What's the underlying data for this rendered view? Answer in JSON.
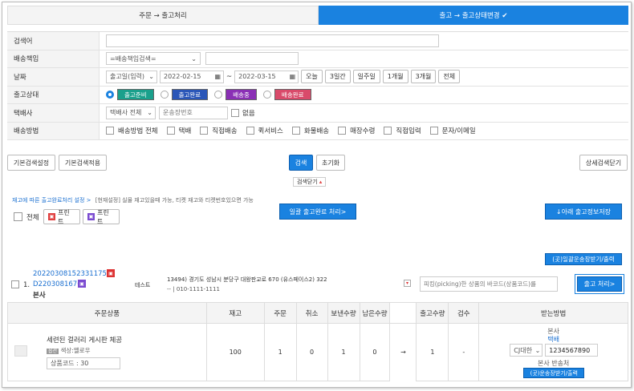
{
  "tabs": [
    {
      "label": "주문 → 출고처리"
    },
    {
      "label": "출고 → 출고상태변경 ✔"
    }
  ],
  "form": {
    "search_label": "검색어",
    "shipping_label": "배송책임",
    "shipping_select": "=배송책임검색=",
    "date_label": "날짜",
    "date_type": "출고일(입력)",
    "date_from": "2022-02-15",
    "date_sep": "~",
    "date_to": "2022-03-15",
    "date_buttons": [
      "오늘",
      "3일간",
      "일주일",
      "1개월",
      "3개월",
      "전체"
    ],
    "status_label": "출고상태",
    "statuses": [
      "출고준비",
      "출고완료",
      "배송중",
      "배송완료"
    ],
    "carrier_label": "택배사",
    "carrier_select": "택배사 전체",
    "tracking_placeholder": "운송장번호",
    "none_label": "없음",
    "method_label": "배송방법",
    "methods": [
      "배송방법 전체",
      "택배",
      "직접배송",
      "퀵서비스",
      "화물배송",
      "매장수령",
      "직접입력",
      "문자/이메일"
    ]
  },
  "actions": {
    "basic_save": "기본검색설정",
    "basic_apply": "기본검색적용",
    "search": "검색",
    "reset": "초기화",
    "detail_close": "상세검색닫기",
    "search_close": "검색닫기"
  },
  "notice": {
    "link": "재고에 따른 출고완료처리 설정 >",
    "text": "[현재설정] 실물 재고있을때 가능,  티켓 재고와 티켓번호있으면 가능"
  },
  "list_toolbar": {
    "all_label": "전체",
    "print1": "프린트",
    "print2": "프린트",
    "bulk_complete": "일괄 출고완료 처리>",
    "save_below": "↓아래 출고정보저장",
    "bulk_tracking": "(곳)일괄운송장받기/출력"
  },
  "order": {
    "index": "1.",
    "order_no": "2022030815233117531",
    "sub_no": "D2203081676",
    "store": "본사",
    "buyer": "테스트",
    "address": "13494) 경기도 성남시 분당구 대왕판교로 670 (유스페이스2) 322",
    "contact": "--  |  010-1111-1111",
    "barcode_placeholder": "피킹(picking)한 상품의 바코드(상품코드)를",
    "process_btn": "출고 처리>"
  },
  "grid": {
    "headers": [
      "주문상품",
      "재고",
      "주문",
      "취소",
      "보낸수량",
      "남은수량",
      "",
      "출고수량",
      "검수",
      "받는방법"
    ],
    "row": {
      "product": "세련된 걸러리 게시판 체공",
      "option_tag": "옵션",
      "option": "색상:옐로우",
      "code": "상품코드 : 30",
      "stock": "100",
      "ordered": "1",
      "cancel": "0",
      "sent": "1",
      "remain": "0",
      "arrow": "→",
      "ship_qty": "1",
      "inspect": "-",
      "recv_store": "본사",
      "recv_method": "택배",
      "carrier": "CJ대한",
      "tracking": "1234567890",
      "shipper": "본사 반송처",
      "tracking_btn": "(곳)운송장받기/출력"
    }
  },
  "colors": {
    "primary": "#1a82e0",
    "ready": "#1aa08c",
    "done": "#2a56b8",
    "shipping": "#8a2fb5",
    "delivered": "#d94a6a",
    "print_red": "#e04040",
    "print_purple": "#7a4ad0"
  }
}
